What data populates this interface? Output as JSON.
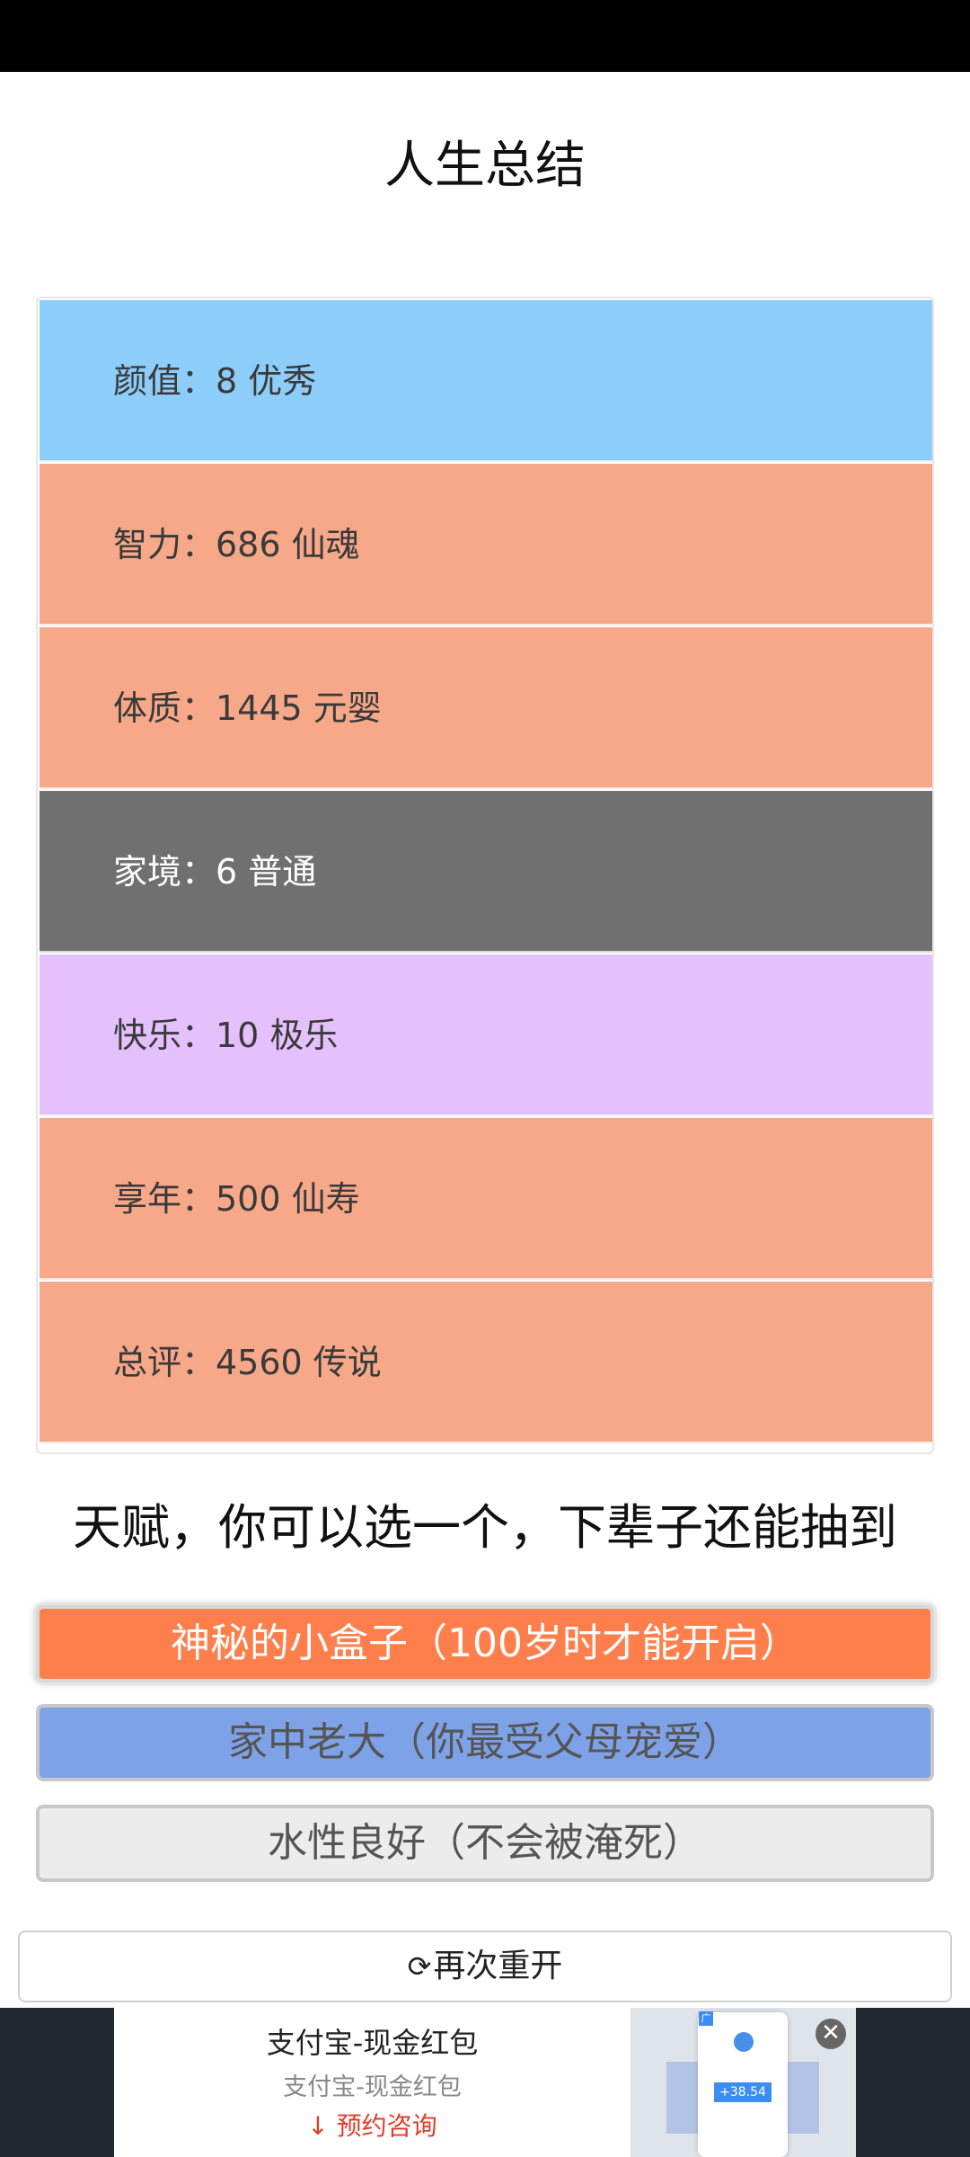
{
  "title": "人生总结",
  "stats": [
    {
      "label": "颜值：8 优秀",
      "bg": "#8ccdfa",
      "tone": "light"
    },
    {
      "label": "智力：686 仙魂",
      "bg": "#f6a889",
      "tone": "light"
    },
    {
      "label": "体质：1445 元婴",
      "bg": "#f6a889",
      "tone": "light"
    },
    {
      "label": "家境：6 普通",
      "bg": "#707070",
      "tone": "dark"
    },
    {
      "label": "快乐：10 极乐",
      "bg": "#e4c0fd",
      "tone": "light"
    },
    {
      "label": "享年：500 仙寿",
      "bg": "#f6a889",
      "tone": "light"
    },
    {
      "label": "总评：4560 传说",
      "bg": "#f6a889",
      "tone": "light"
    }
  ],
  "talent_heading": "天赋，你可以选一个，下辈子还能抽到",
  "talents": [
    {
      "label": "神秘的小盒子（100岁时才能开启）",
      "bg": "#ff7f4c",
      "color": "#ffffff",
      "selected": true
    },
    {
      "label": "家中老大（你最受父母宠爱）",
      "bg": "#7ea2e8",
      "color": "#555555",
      "selected": false
    },
    {
      "label": "水性良好（不会被淹死）",
      "bg": "#ececec",
      "color": "#555555",
      "selected": false
    }
  ],
  "restart": {
    "icon": "refresh-icon",
    "icon_glyph": "⟳",
    "label": "再次重开"
  },
  "ad": {
    "title": "支付宝-现金红包",
    "subtitle": "支付宝-现金红包",
    "cta": "预约咨询",
    "cta_icon": "download-arrow-icon",
    "cta_glyph": "↓",
    "amount": "+38.54",
    "close_glyph": "✕",
    "badge": "广"
  }
}
